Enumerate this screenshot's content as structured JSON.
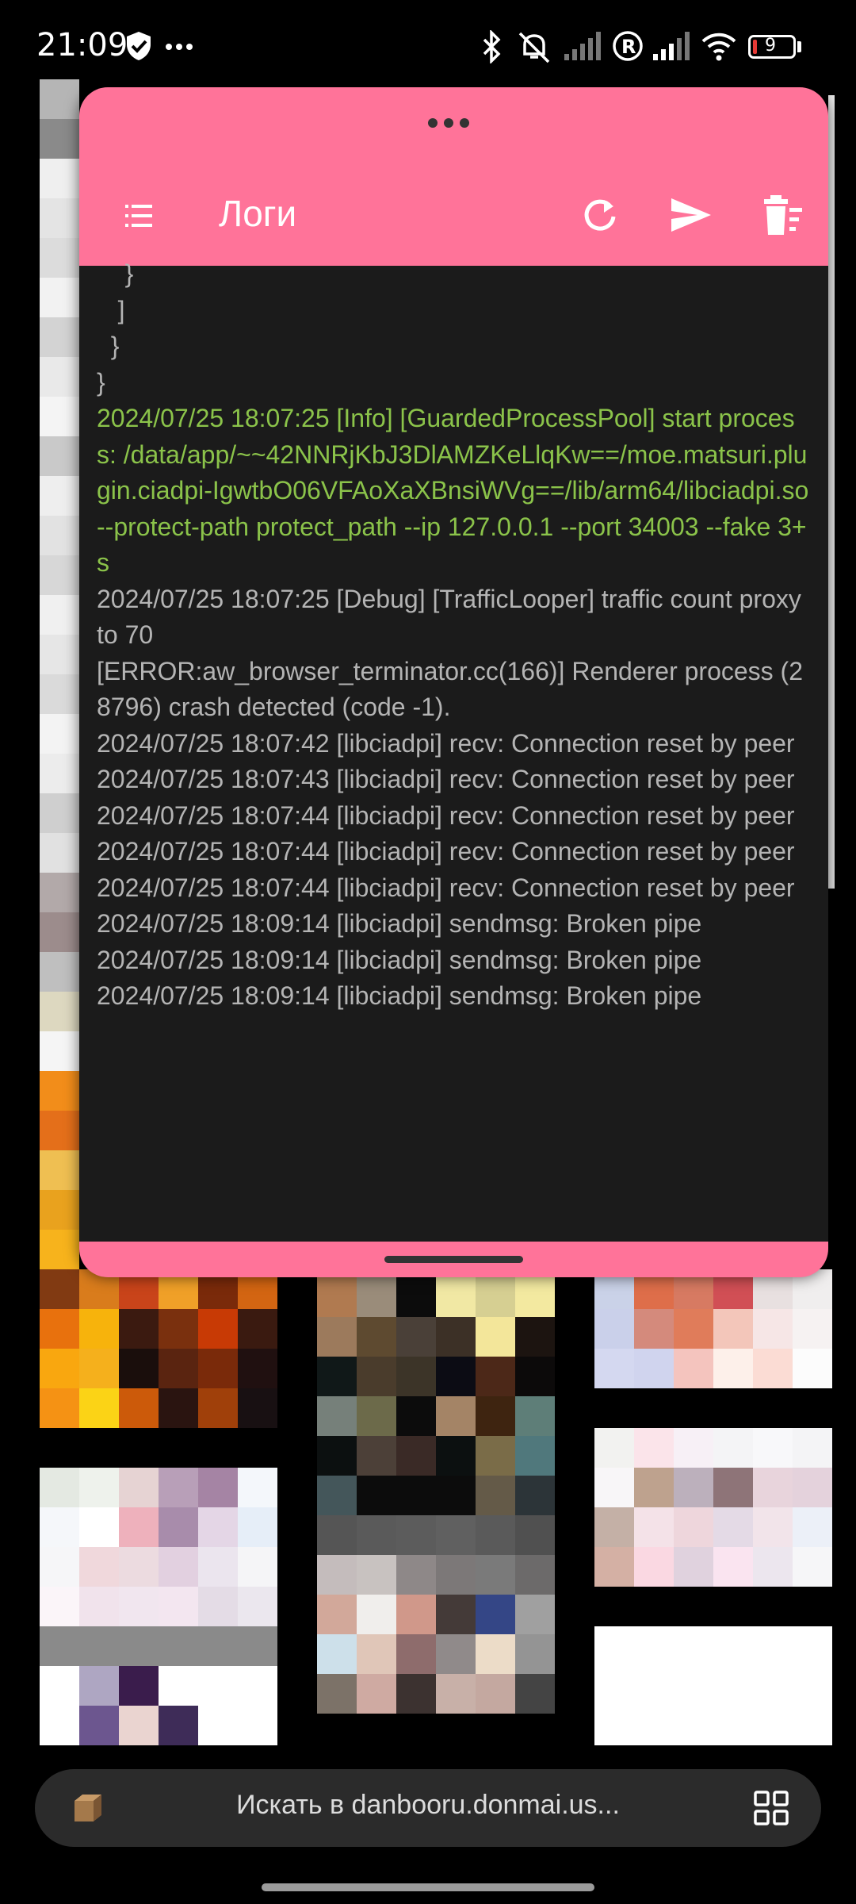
{
  "status_bar": {
    "time": "21:09",
    "icons": [
      "shield-check-icon",
      "more-dots-icon",
      "bluetooth-icon",
      "mute-icon",
      "signal-icon",
      "roaming-icon",
      "signal-icon",
      "wifi-icon",
      "battery-icon"
    ],
    "battery": "9",
    "battery_color": "#e53935"
  },
  "window": {
    "title": "Логи",
    "accent_color": "#ff7399",
    "actions": [
      "menu-icon",
      "refresh-icon",
      "send-icon",
      "clear-log-icon"
    ]
  },
  "log": {
    "lines": [
      {
        "text": "    }",
        "level": "plain"
      },
      {
        "text": "   ]",
        "level": "plain"
      },
      {
        "text": "  }",
        "level": "plain"
      },
      {
        "text": "}",
        "level": "plain"
      },
      {
        "text": "2024/07/25 18:07:25 [Info] [GuardedProcessPool] start process: /data/app/~~42NNRjKbJ3DlAMZKeLlqKw==/moe.matsuri.plugin.ciadpi-IgwtbO06VFAoXaXBnsiWVg==/lib/arm64/libciadpi.so --protect-path protect_path --ip 127.0.0.1 --port 34003 --fake 3+s",
        "level": "info"
      },
      {
        "text": "2024/07/25 18:07:25 [Debug] [TrafficLooper] traffic count proxy to 70",
        "level": "plain"
      },
      {
        "text": "[ERROR:aw_browser_terminator.cc(166)] Renderer process (28796) crash detected (code -1).",
        "level": "plain"
      },
      {
        "text": "2024/07/25 18:07:42 [libciadpi] recv: Connection reset by peer",
        "level": "plain"
      },
      {
        "text": "2024/07/25 18:07:43 [libciadpi] recv: Connection reset by peer",
        "level": "plain"
      },
      {
        "text": "2024/07/25 18:07:44 [libciadpi] recv: Connection reset by peer",
        "level": "plain"
      },
      {
        "text": "2024/07/25 18:07:44 [libciadpi] recv: Connection reset by peer",
        "level": "plain"
      },
      {
        "text": "2024/07/25 18:07:44 [libciadpi] recv: Connection reset by peer",
        "level": "plain"
      },
      {
        "text": "2024/07/25 18:09:14 [libciadpi] sendmsg: Broken pipe",
        "level": "plain"
      },
      {
        "text": "2024/07/25 18:09:14 [libciadpi] sendmsg: Broken pipe",
        "level": "plain"
      },
      {
        "text": "2024/07/25 18:09:14 [libciadpi] sendmsg: Broken pipe",
        "level": "plain"
      }
    ]
  },
  "browser": {
    "search_placeholder": "Искать в danbooru.donmai.us...",
    "left_icon": "tabs-box-icon",
    "right_icon": "apps-grid-icon"
  }
}
